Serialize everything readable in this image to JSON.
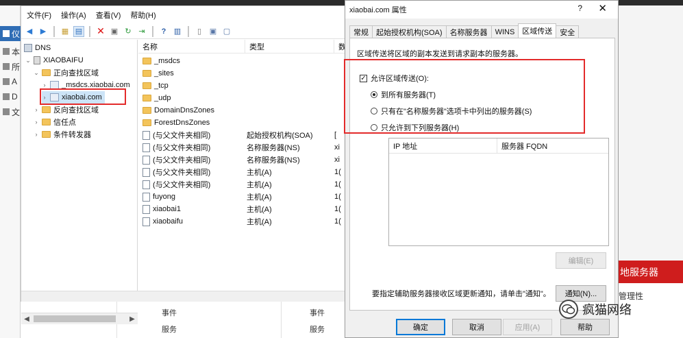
{
  "dns_manager": {
    "menu": [
      "文件(F)",
      "操作(A)",
      "查看(V)",
      "帮助(H)"
    ],
    "toolbar_icons": [
      "back-arrow-icon",
      "forward-arrow-icon",
      "folder-up-icon",
      "list-view-icon",
      "delete-icon",
      "properties-icon",
      "refresh-icon",
      "export-icon",
      "help-icon",
      "console-icon",
      "server-icon",
      "domain-icon",
      "record-icon"
    ],
    "tree": {
      "root": "DNS",
      "server": "XIAOBAIFU",
      "forward_zones": "正向查找区域",
      "msdcs": "_msdcs.xiaobai.com",
      "selected_zone": "xiaobai.com",
      "reverse_zones": "反向查找区域",
      "trust_points": "信任点",
      "conditional_forwarders": "条件转发器"
    },
    "columns": [
      "名称",
      "类型",
      "数"
    ],
    "rows": [
      {
        "name": "_msdcs",
        "type": "",
        "data": "",
        "kind": "folder"
      },
      {
        "name": "_sites",
        "type": "",
        "data": "",
        "kind": "folder"
      },
      {
        "name": "_tcp",
        "type": "",
        "data": "",
        "kind": "folder"
      },
      {
        "name": "_udp",
        "type": "",
        "data": "",
        "kind": "folder"
      },
      {
        "name": "DomainDnsZones",
        "type": "",
        "data": "",
        "kind": "folder"
      },
      {
        "name": "ForestDnsZones",
        "type": "",
        "data": "",
        "kind": "folder"
      },
      {
        "name": "(与父文件夹相同)",
        "type": "起始授权机构(SOA)",
        "data": "[",
        "kind": "record"
      },
      {
        "name": "(与父文件夹相同)",
        "type": "名称服务器(NS)",
        "data": "xi",
        "kind": "record"
      },
      {
        "name": "(与父文件夹相同)",
        "type": "名称服务器(NS)",
        "data": "xi",
        "kind": "record"
      },
      {
        "name": "(与父文件夹相同)",
        "type": "主机(A)",
        "data": "1(",
        "kind": "record"
      },
      {
        "name": "(与父文件夹相同)",
        "type": "主机(A)",
        "data": "1(",
        "kind": "record"
      },
      {
        "name": "fuyong",
        "type": "主机(A)",
        "data": "1(",
        "kind": "record"
      },
      {
        "name": "xiaobai1",
        "type": "主机(A)",
        "data": "1(",
        "kind": "record"
      },
      {
        "name": "xiaobaifu",
        "type": "主机(A)",
        "data": "1(",
        "kind": "record"
      }
    ]
  },
  "left_nav": [
    "仪",
    "本",
    "所",
    "A",
    "D",
    "文"
  ],
  "underlying": {
    "events_1": "事件",
    "services_1": "服务",
    "events_2": "事件",
    "services_2": "服务",
    "red_panel": "地服务器",
    "manage_text": "管理性"
  },
  "dialog": {
    "title": "xiaobai.com 属性",
    "help": "?",
    "close": "✕",
    "tabs": [
      "常规",
      "起始授权机构(SOA)",
      "名称服务器",
      "WINS",
      "区域传送",
      "安全"
    ],
    "active_tab": 4,
    "description": "区域传送将区域的副本发送到请求副本的服务器。",
    "allow_transfer_label": "允许区域传送(O):",
    "allow_transfer_checked": true,
    "options": [
      {
        "label": "到所有服务器(T)",
        "selected": true
      },
      {
        "label": "只有在\"名称服务器\"选项卡中列出的服务器(S)",
        "selected": false
      },
      {
        "label": "只允许到下列服务器(H)",
        "selected": false
      }
    ],
    "list_columns": [
      "IP 地址",
      "服务器 FQDN"
    ],
    "edit_button": "编辑(E)",
    "notify_hint": "要指定辅助服务器接收区域更新通知，请单击\"通知\"。",
    "notify_button": "通知(N)...",
    "buttons": {
      "ok": "确定",
      "cancel": "取消",
      "apply": "应用(A)",
      "help": "帮助"
    }
  },
  "watermark": {
    "text": "疯猫网络"
  },
  "colors": {
    "annotation_red": "#e32a2a",
    "panel_red": "#cf1d1d",
    "selection": "#cce4f7"
  }
}
